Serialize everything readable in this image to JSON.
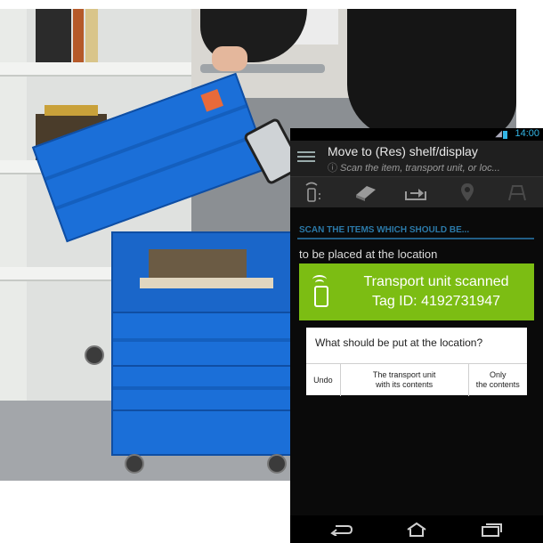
{
  "status_bar": {
    "time": "14:00"
  },
  "action_bar": {
    "title": "Move to (Res) shelf/display",
    "subtitle": "Scan the item, transport unit, or loc..."
  },
  "toolbar": {
    "buttons": [
      {
        "icon": "rfid-phone-icon"
      },
      {
        "icon": "book-icon"
      },
      {
        "icon": "tray-arrow-icon"
      },
      {
        "icon": "location-pin-icon"
      },
      {
        "icon": "shelf-icon"
      }
    ]
  },
  "content": {
    "section_header": "SCAN THE ITEMS WHICH SHOULD BE...",
    "location_text": "to be placed at the location"
  },
  "toast": {
    "title": "Transport unit scanned",
    "tag": "Tag ID: 4192731947",
    "color": "#7cbd13"
  },
  "dialog": {
    "question": "What should be put at the location?",
    "buttons": {
      "undo": "Undo",
      "with_contents_line1": "The transport unit",
      "with_contents_line2": "with its contents",
      "only_line1": "Only",
      "only_line2": "the contents"
    }
  },
  "nav_bar": {
    "back": "back-icon",
    "home": "home-icon",
    "recent": "recent-apps-icon"
  },
  "colors": {
    "accent": "#33b5e5",
    "header_blue": "#2b79a8",
    "crate_blue": "#1b6fd8"
  }
}
